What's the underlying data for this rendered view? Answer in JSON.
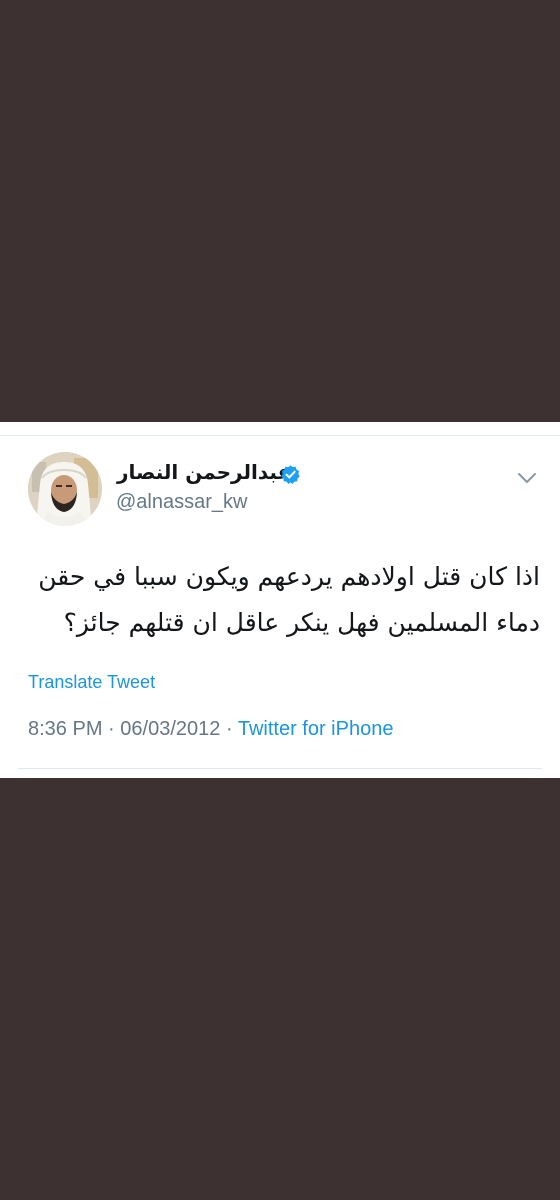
{
  "tweet": {
    "display_name": "عبدالرحمن النصار",
    "handle": "@alnassar_kw",
    "verified": true,
    "text": "اذا كان قتل اولادهم يردعهم ويكون سببا في حقن دماء المسلمين فهل ينكر عاقل ان قتلهم جائز؟",
    "translate_label": "Translate Tweet",
    "time": "8:36 PM",
    "date": "06/03/2012",
    "separator": "·",
    "source": "Twitter for iPhone"
  },
  "colors": {
    "background": "#3d3231",
    "card": "#ffffff",
    "link": "#1b95e0",
    "muted": "#657786",
    "text": "#14171a",
    "verified": "#1da1f2"
  },
  "icons": {
    "verified": "verified-badge-icon",
    "menu": "chevron-down-icon",
    "avatar": "profile-photo"
  }
}
